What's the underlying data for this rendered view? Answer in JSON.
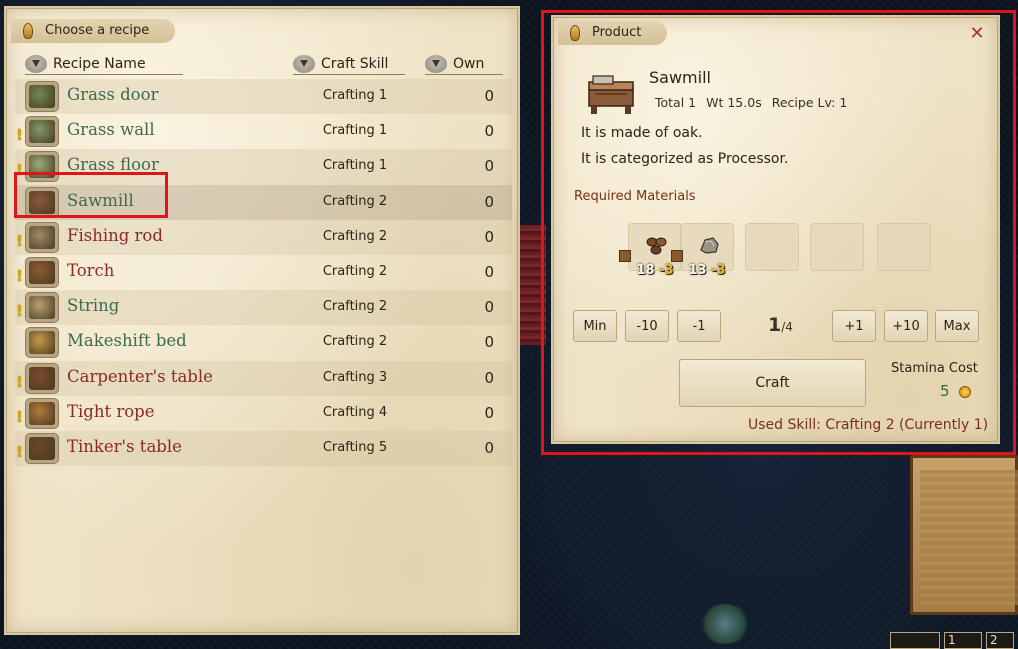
{
  "recipe_panel": {
    "title": "Choose a recipe",
    "columns": {
      "name": "Recipe Name",
      "skill": "Craft Skill",
      "own": "Own"
    },
    "recipes": [
      {
        "name": "Grass door",
        "skill": "Crafting 1",
        "own": "0",
        "available": true,
        "warning": false,
        "icon": "grass-door-icon",
        "color": "#6e8a52"
      },
      {
        "name": "Grass wall",
        "skill": "Crafting 1",
        "own": "0",
        "available": true,
        "warning": true,
        "icon": "grass-wall-icon",
        "color": "#7f9a6a"
      },
      {
        "name": "Grass floor",
        "skill": "Crafting 1",
        "own": "0",
        "available": true,
        "warning": true,
        "icon": "grass-floor-icon",
        "color": "#9aae7a"
      },
      {
        "name": "Sawmill",
        "skill": "Crafting 2",
        "own": "0",
        "available": true,
        "warning": false,
        "icon": "sawmill-icon",
        "color": "#8a5a3a",
        "selected": true
      },
      {
        "name": "Fishing rod",
        "skill": "Crafting 2",
        "own": "0",
        "available": false,
        "warning": true,
        "icon": "fishing-rod-icon",
        "color": "#a08a6a"
      },
      {
        "name": "Torch",
        "skill": "Crafting 2",
        "own": "0",
        "available": false,
        "warning": true,
        "icon": "torch-icon",
        "color": "#8a5a30"
      },
      {
        "name": "String",
        "skill": "Crafting 2",
        "own": "0",
        "available": true,
        "warning": true,
        "icon": "string-icon",
        "color": "#b9a070"
      },
      {
        "name": "Makeshift bed",
        "skill": "Crafting 2",
        "own": "0",
        "available": true,
        "warning": false,
        "icon": "makeshift-bed-icon",
        "color": "#c69a4a"
      },
      {
        "name": "Carpenter's table",
        "skill": "Crafting 3",
        "own": "0",
        "available": false,
        "warning": true,
        "icon": "carpenters-table-icon",
        "color": "#7a4a2a"
      },
      {
        "name": "Tight rope",
        "skill": "Crafting 4",
        "own": "0",
        "available": false,
        "warning": true,
        "icon": "tight-rope-icon",
        "color": "#b07a3a"
      },
      {
        "name": "Tinker's table",
        "skill": "Crafting 5",
        "own": "0",
        "available": false,
        "warning": true,
        "icon": "tinkers-table-icon",
        "color": "#6a4a2a"
      }
    ]
  },
  "product_panel": {
    "title": "Product",
    "name": "Sawmill",
    "total": "Total 1",
    "weight": "Wt 15.0s",
    "recipe_level": "Recipe Lv: 1",
    "desc_lines": [
      "It is made of oak.",
      "It is categorized as Processor."
    ],
    "required_label": "Required Materials",
    "materials": [
      {
        "icon": "oak-log-icon",
        "qty": "18",
        "delta": "-3"
      },
      {
        "icon": "stone-icon",
        "qty": "13",
        "delta": "-3"
      }
    ],
    "buttons": {
      "min": "Min",
      "minus10": "-10",
      "minus1": "-1",
      "plus1": "+1",
      "plus10": "+10",
      "max": "Max"
    },
    "quantity": {
      "current": "1",
      "total": "/4"
    },
    "craft_label": "Craft",
    "stamina_label": "Stamina Cost",
    "stamina_value": "5",
    "used_skill": "Used Skill: Crafting 2 (Currently 1)"
  },
  "hotbar": {
    "slot1": "1",
    "slot2": "2"
  }
}
